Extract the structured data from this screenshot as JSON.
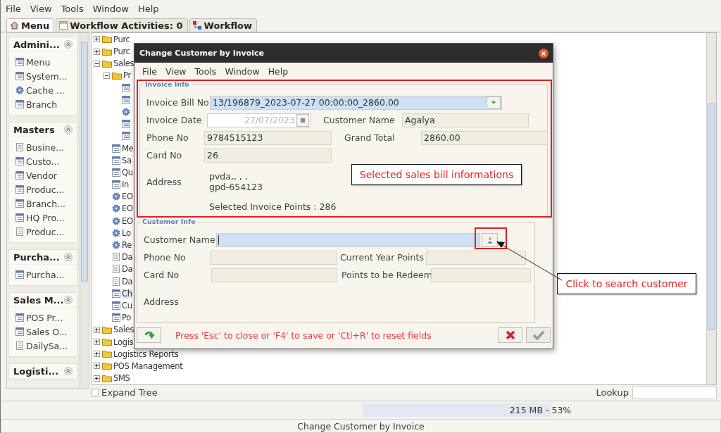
{
  "menu": [
    "File",
    "View",
    "Tools",
    "Window",
    "Help"
  ],
  "tabs": [
    {
      "label": "Menu",
      "kind": "home",
      "selected": true
    },
    {
      "label": "Workflow Activities: 0",
      "kind": "list",
      "selected": false
    },
    {
      "label": "Workflow",
      "kind": "flow",
      "selected": false
    }
  ],
  "sidebar": {
    "groups": [
      {
        "title": "Admini...",
        "expanded": true,
        "items": [
          {
            "label": "Menu",
            "kind": "form"
          },
          {
            "label": "System...",
            "kind": "form"
          },
          {
            "label": "Cache ...",
            "kind": "process"
          },
          {
            "label": "Branch",
            "kind": "form"
          }
        ]
      },
      {
        "title": "Masters",
        "expanded": true,
        "items": [
          {
            "label": "Busine...",
            "kind": "report"
          },
          {
            "label": "Custo...",
            "kind": "form"
          },
          {
            "label": "Vendor",
            "kind": "form"
          },
          {
            "label": "Produc...",
            "kind": "form"
          },
          {
            "label": "Branch...",
            "kind": "form"
          },
          {
            "label": "HQ Pro...",
            "kind": "form"
          },
          {
            "label": "Produc...",
            "kind": "report"
          }
        ]
      },
      {
        "title": "Purcha...",
        "expanded": true,
        "items": [
          {
            "label": "Purcha...",
            "kind": "form"
          }
        ]
      },
      {
        "title": "Sales M...",
        "expanded": true,
        "items": [
          {
            "label": "POS Pr...",
            "kind": "form"
          },
          {
            "label": "Sales O...",
            "kind": "form"
          },
          {
            "label": "DailySa...",
            "kind": "report"
          }
        ]
      },
      {
        "title": "Logisti...",
        "expanded": true
      }
    ]
  },
  "tree": {
    "items": [
      {
        "label": "Purc",
        "kind": "folder",
        "expanded": false,
        "selected": false
      },
      {
        "label": "Purc",
        "kind": "folder",
        "expanded": false,
        "selected": false
      },
      {
        "label": "Sales",
        "kind": "folder",
        "expanded": true,
        "selected": false,
        "children": [
          {
            "label": "Pr",
            "kind": "folder",
            "expanded": true,
            "selected": false,
            "children": [
              {
                "kind": "form",
                "selected": false
              },
              {
                "kind": "form",
                "selected": false
              },
              {
                "kind": "process",
                "selected": false
              },
              {
                "kind": "form",
                "selected": false
              },
              {
                "kind": "form",
                "selected": false
              }
            ]
          },
          {
            "label": "Me",
            "kind": "form",
            "selected": false
          },
          {
            "label": "Sa",
            "kind": "form",
            "selected": false
          },
          {
            "label": "Qu",
            "kind": "form",
            "selected": false
          },
          {
            "label": "In",
            "kind": "form",
            "selected": false
          },
          {
            "label": "EO",
            "kind": "process",
            "selected": false
          },
          {
            "label": "EO",
            "kind": "process",
            "selected": false
          },
          {
            "label": "EO",
            "kind": "process",
            "selected": false
          },
          {
            "label": "Lo",
            "kind": "process",
            "selected": false
          },
          {
            "label": "Re",
            "kind": "process",
            "selected": false
          },
          {
            "label": "Da",
            "kind": "report",
            "selected": false
          },
          {
            "label": "Da",
            "kind": "report",
            "selected": false
          },
          {
            "label": "Da",
            "kind": "report",
            "selected": false
          },
          {
            "label": "Ch",
            "kind": "form",
            "selected": true
          },
          {
            "label": "Cu",
            "kind": "form",
            "selected": false
          },
          {
            "label": "Po",
            "kind": "form",
            "selected": false
          }
        ]
      },
      {
        "label": "Sales",
        "kind": "folder",
        "expanded": false,
        "selected": false
      },
      {
        "label": "Logis",
        "kind": "folder",
        "expanded": false,
        "selected": false
      },
      {
        "label": "Logistics Reports",
        "kind": "folder",
        "expanded": false,
        "selected": false
      },
      {
        "label": "POS Management",
        "kind": "folder",
        "expanded": false,
        "selected": false
      },
      {
        "label": "SMS",
        "kind": "folder",
        "expanded": false,
        "selected": false
      }
    ]
  },
  "expand_tree": {
    "label": "Expand Tree",
    "checked": false
  },
  "lookup": {
    "label": "Lookup"
  },
  "memory": {
    "text": "215 MB - 53%",
    "level": 0.53
  },
  "status_bar": "Change Customer by Invoice",
  "dialog": {
    "title": "Change Customer by Invoice",
    "menu": [
      "File",
      "View",
      "Tools",
      "Window",
      "Help"
    ],
    "invoice_info": {
      "title": "Invoice Info",
      "bill_no": {
        "label": "Invoice Bill No",
        "value": "13/196879_2023-07-27 00:00:00_2860.00"
      },
      "date": {
        "label": "Invoice Date",
        "value": "27/07/2023",
        "disabled": true
      },
      "customer_name": {
        "label": "Customer Name",
        "value": "Agalya"
      },
      "phone": {
        "label": "Phone No",
        "value": "9784515123"
      },
      "grand_total": {
        "label": "Grand Total",
        "value": "2860.00"
      },
      "card": {
        "label": "Card No",
        "value": "26"
      },
      "address": {
        "label": "Address",
        "lines": [
          "pvda,, , ,",
          "gpd-654123"
        ]
      },
      "points": "Selected Invoice Points : 286"
    },
    "customer_info": {
      "title": "Customer Info",
      "customer_name": {
        "label": "Customer Name",
        "focused": true
      },
      "phone": {
        "label": "Phone No"
      },
      "current_points": {
        "label": "Current Year Points"
      },
      "card": {
        "label": "Card No"
      },
      "redeem": {
        "label": "Points to be Redeem"
      },
      "address": {
        "label": "Address"
      }
    },
    "footer": {
      "message": "Press 'Esc' to close or 'F4' to save or 'Ctl+R' to reset fields",
      "ok_disabled": true
    }
  },
  "annotations": [
    {
      "text": "Selected sales bill informations"
    },
    {
      "text": "Click to search customer"
    }
  ]
}
